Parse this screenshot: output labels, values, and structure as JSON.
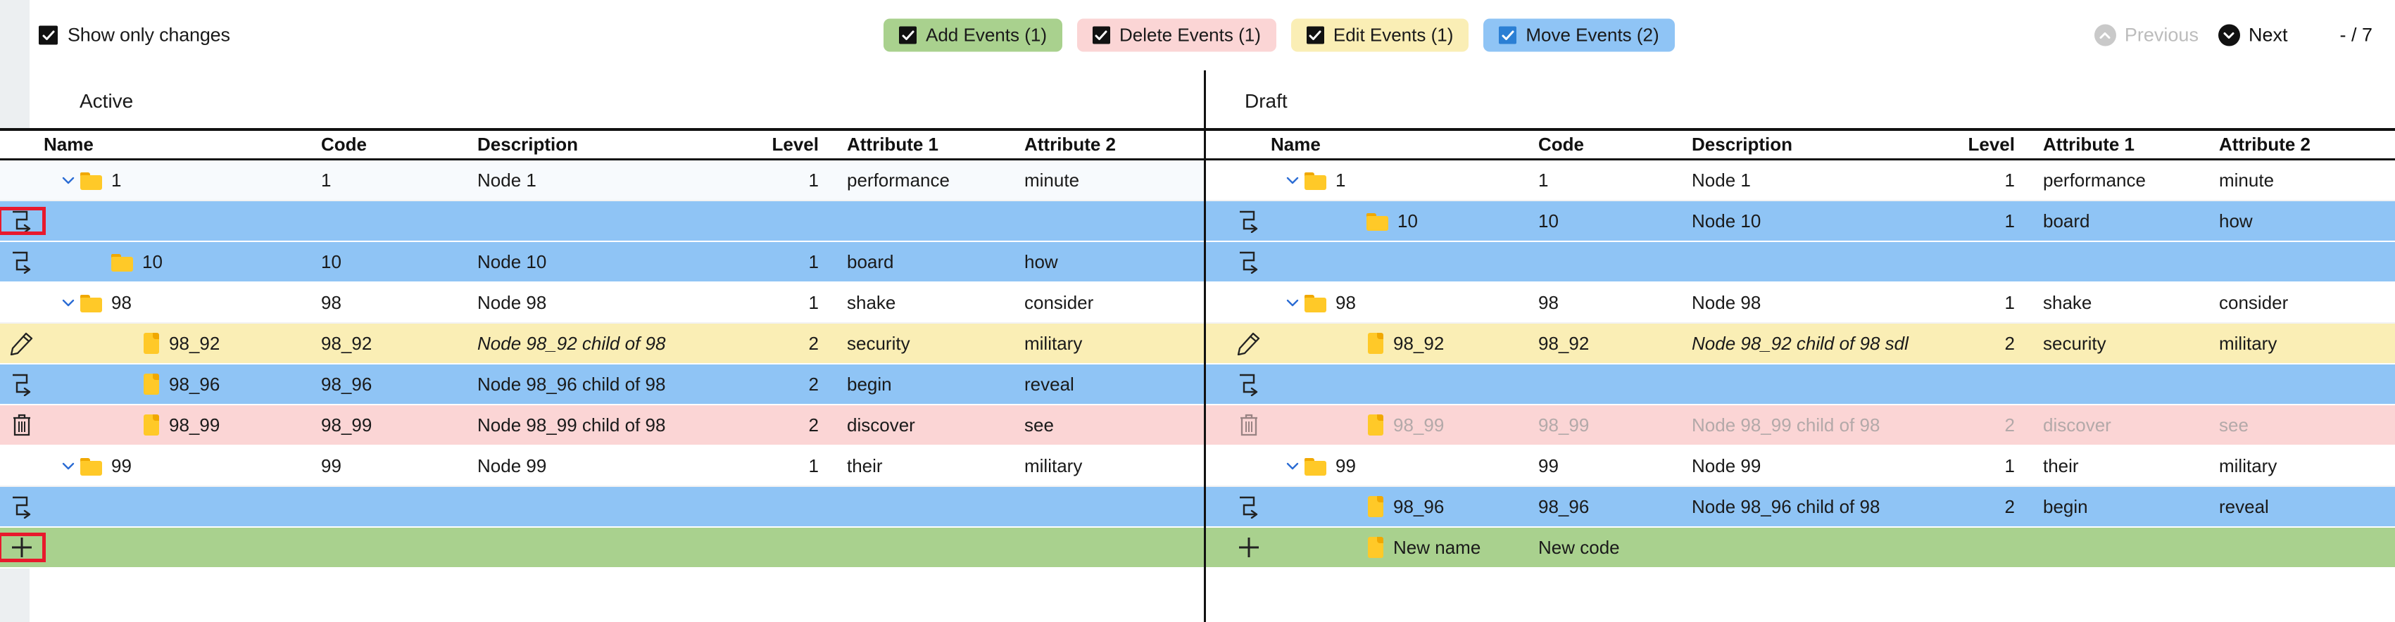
{
  "toolbar": {
    "show_only_changes_label": "Show only changes",
    "show_only_changes_checked": true,
    "filters": [
      {
        "label": "Add Events (1)",
        "color": "#a9d18e",
        "checked": true,
        "kind": "add"
      },
      {
        "label": "Delete Events (1)",
        "color": "#fbd5d5",
        "checked": true,
        "kind": "delete"
      },
      {
        "label": "Edit Events (1)",
        "color": "#faeeb5",
        "checked": true,
        "kind": "edit"
      },
      {
        "label": "Move Events (2)",
        "color": "#8fc4f5",
        "checked": true,
        "kind": "move"
      }
    ],
    "previous_label": "Previous",
    "next_label": "Next",
    "page_count": "- / 7"
  },
  "columns": [
    "Name",
    "Code",
    "Description",
    "Level",
    "Attribute 1",
    "Attribute 2"
  ],
  "left_panel": {
    "title": "Active",
    "rows": [
      {
        "icon": "",
        "tint": "first",
        "chev": "down",
        "indent": 0,
        "node": "folder",
        "name": "1",
        "code": "1",
        "desc": "Node 1",
        "level": "1",
        "attr1": "performance",
        "attr2": "minute"
      },
      {
        "icon": "move",
        "tint": "move",
        "chev": "none",
        "indent": 0,
        "node": "none",
        "name": "",
        "code": "",
        "desc": "",
        "level": "",
        "attr1": "",
        "attr2": "",
        "highlight_icon": true
      },
      {
        "icon": "move",
        "tint": "move",
        "chev": "none",
        "indent": 1,
        "node": "folder",
        "name": "10",
        "code": "10",
        "desc": "Node 10",
        "level": "1",
        "attr1": "board",
        "attr2": "how"
      },
      {
        "icon": "",
        "tint": "plain",
        "chev": "down",
        "indent": 0,
        "node": "folder",
        "name": "98",
        "code": "98",
        "desc": "Node 98",
        "level": "1",
        "attr1": "shake",
        "attr2": "consider"
      },
      {
        "icon": "edit",
        "tint": "edit",
        "chev": "none",
        "indent": 2,
        "node": "file",
        "name": "98_92",
        "code": "98_92",
        "desc": "Node 98_92 child of 98",
        "level": "2",
        "attr1": "security",
        "attr2": "military",
        "italic": true
      },
      {
        "icon": "move",
        "tint": "move",
        "chev": "none",
        "indent": 2,
        "node": "file",
        "name": "98_96",
        "code": "98_96",
        "desc": "Node 98_96 child of 98",
        "level": "2",
        "attr1": "begin",
        "attr2": "reveal"
      },
      {
        "icon": "trash",
        "tint": "delete",
        "chev": "none",
        "indent": 2,
        "node": "file",
        "name": "98_99",
        "code": "98_99",
        "desc": "Node 98_99 child of 98",
        "level": "2",
        "attr1": "discover",
        "attr2": "see"
      },
      {
        "icon": "",
        "tint": "plain",
        "chev": "down",
        "indent": 0,
        "node": "folder",
        "name": "99",
        "code": "99",
        "desc": "Node 99",
        "level": "1",
        "attr1": "their",
        "attr2": "military"
      },
      {
        "icon": "move",
        "tint": "move",
        "chev": "none",
        "indent": 0,
        "node": "none",
        "name": "",
        "code": "",
        "desc": "",
        "level": "",
        "attr1": "",
        "attr2": ""
      },
      {
        "icon": "plus",
        "tint": "add",
        "chev": "none",
        "indent": 0,
        "node": "none",
        "name": "",
        "code": "",
        "desc": "",
        "level": "",
        "attr1": "",
        "attr2": "",
        "highlight_icon": true
      }
    ]
  },
  "right_panel": {
    "title": "Draft",
    "rows": [
      {
        "icon": "",
        "tint": "plain",
        "chev": "down",
        "indent": 0,
        "node": "folder",
        "name": "1",
        "code": "1",
        "desc": "Node 1",
        "level": "1",
        "attr1": "performance",
        "attr2": "minute"
      },
      {
        "icon": "move",
        "tint": "move",
        "chev": "none",
        "indent": 2,
        "node": "folder",
        "name": "10",
        "code": "10",
        "desc": "Node 10",
        "level": "1",
        "attr1": "board",
        "attr2": "how"
      },
      {
        "icon": "move",
        "tint": "move",
        "chev": "none",
        "indent": 0,
        "node": "none",
        "name": "",
        "code": "",
        "desc": "",
        "level": "",
        "attr1": "",
        "attr2": ""
      },
      {
        "icon": "",
        "tint": "plain",
        "chev": "down",
        "indent": 0,
        "node": "folder",
        "name": "98",
        "code": "98",
        "desc": "Node 98",
        "level": "1",
        "attr1": "shake",
        "attr2": "consider"
      },
      {
        "icon": "edit",
        "tint": "edit",
        "chev": "none",
        "indent": 2,
        "node": "file",
        "name": "98_92",
        "code": "98_92",
        "desc": "Node 98_92 child of 98 sdl",
        "level": "2",
        "attr1": "security",
        "attr2": "military",
        "italic": true
      },
      {
        "icon": "move",
        "tint": "move",
        "chev": "none",
        "indent": 0,
        "node": "none",
        "name": "",
        "code": "",
        "desc": "",
        "level": "",
        "attr1": "",
        "attr2": ""
      },
      {
        "icon": "trash",
        "tint": "delete",
        "chev": "none",
        "indent": 2,
        "node": "file",
        "name": "98_99",
        "code": "98_99",
        "desc": "Node 98_99 child of 98",
        "level": "2",
        "attr1": "discover",
        "attr2": "see",
        "muted": true
      },
      {
        "icon": "",
        "tint": "plain",
        "chev": "down",
        "indent": 0,
        "node": "folder",
        "name": "99",
        "code": "99",
        "desc": "Node 99",
        "level": "1",
        "attr1": "their",
        "attr2": "military"
      },
      {
        "icon": "move",
        "tint": "move",
        "chev": "none",
        "indent": 2,
        "node": "file",
        "name": "98_96",
        "code": "98_96",
        "desc": "Node 98_96 child of 98",
        "level": "2",
        "attr1": "begin",
        "attr2": "reveal"
      },
      {
        "icon": "plus",
        "tint": "add",
        "chev": "none",
        "indent": 2,
        "node": "file",
        "name": "New name",
        "code": "New code",
        "desc": "",
        "level": "",
        "attr1": "",
        "attr2": ""
      }
    ]
  }
}
